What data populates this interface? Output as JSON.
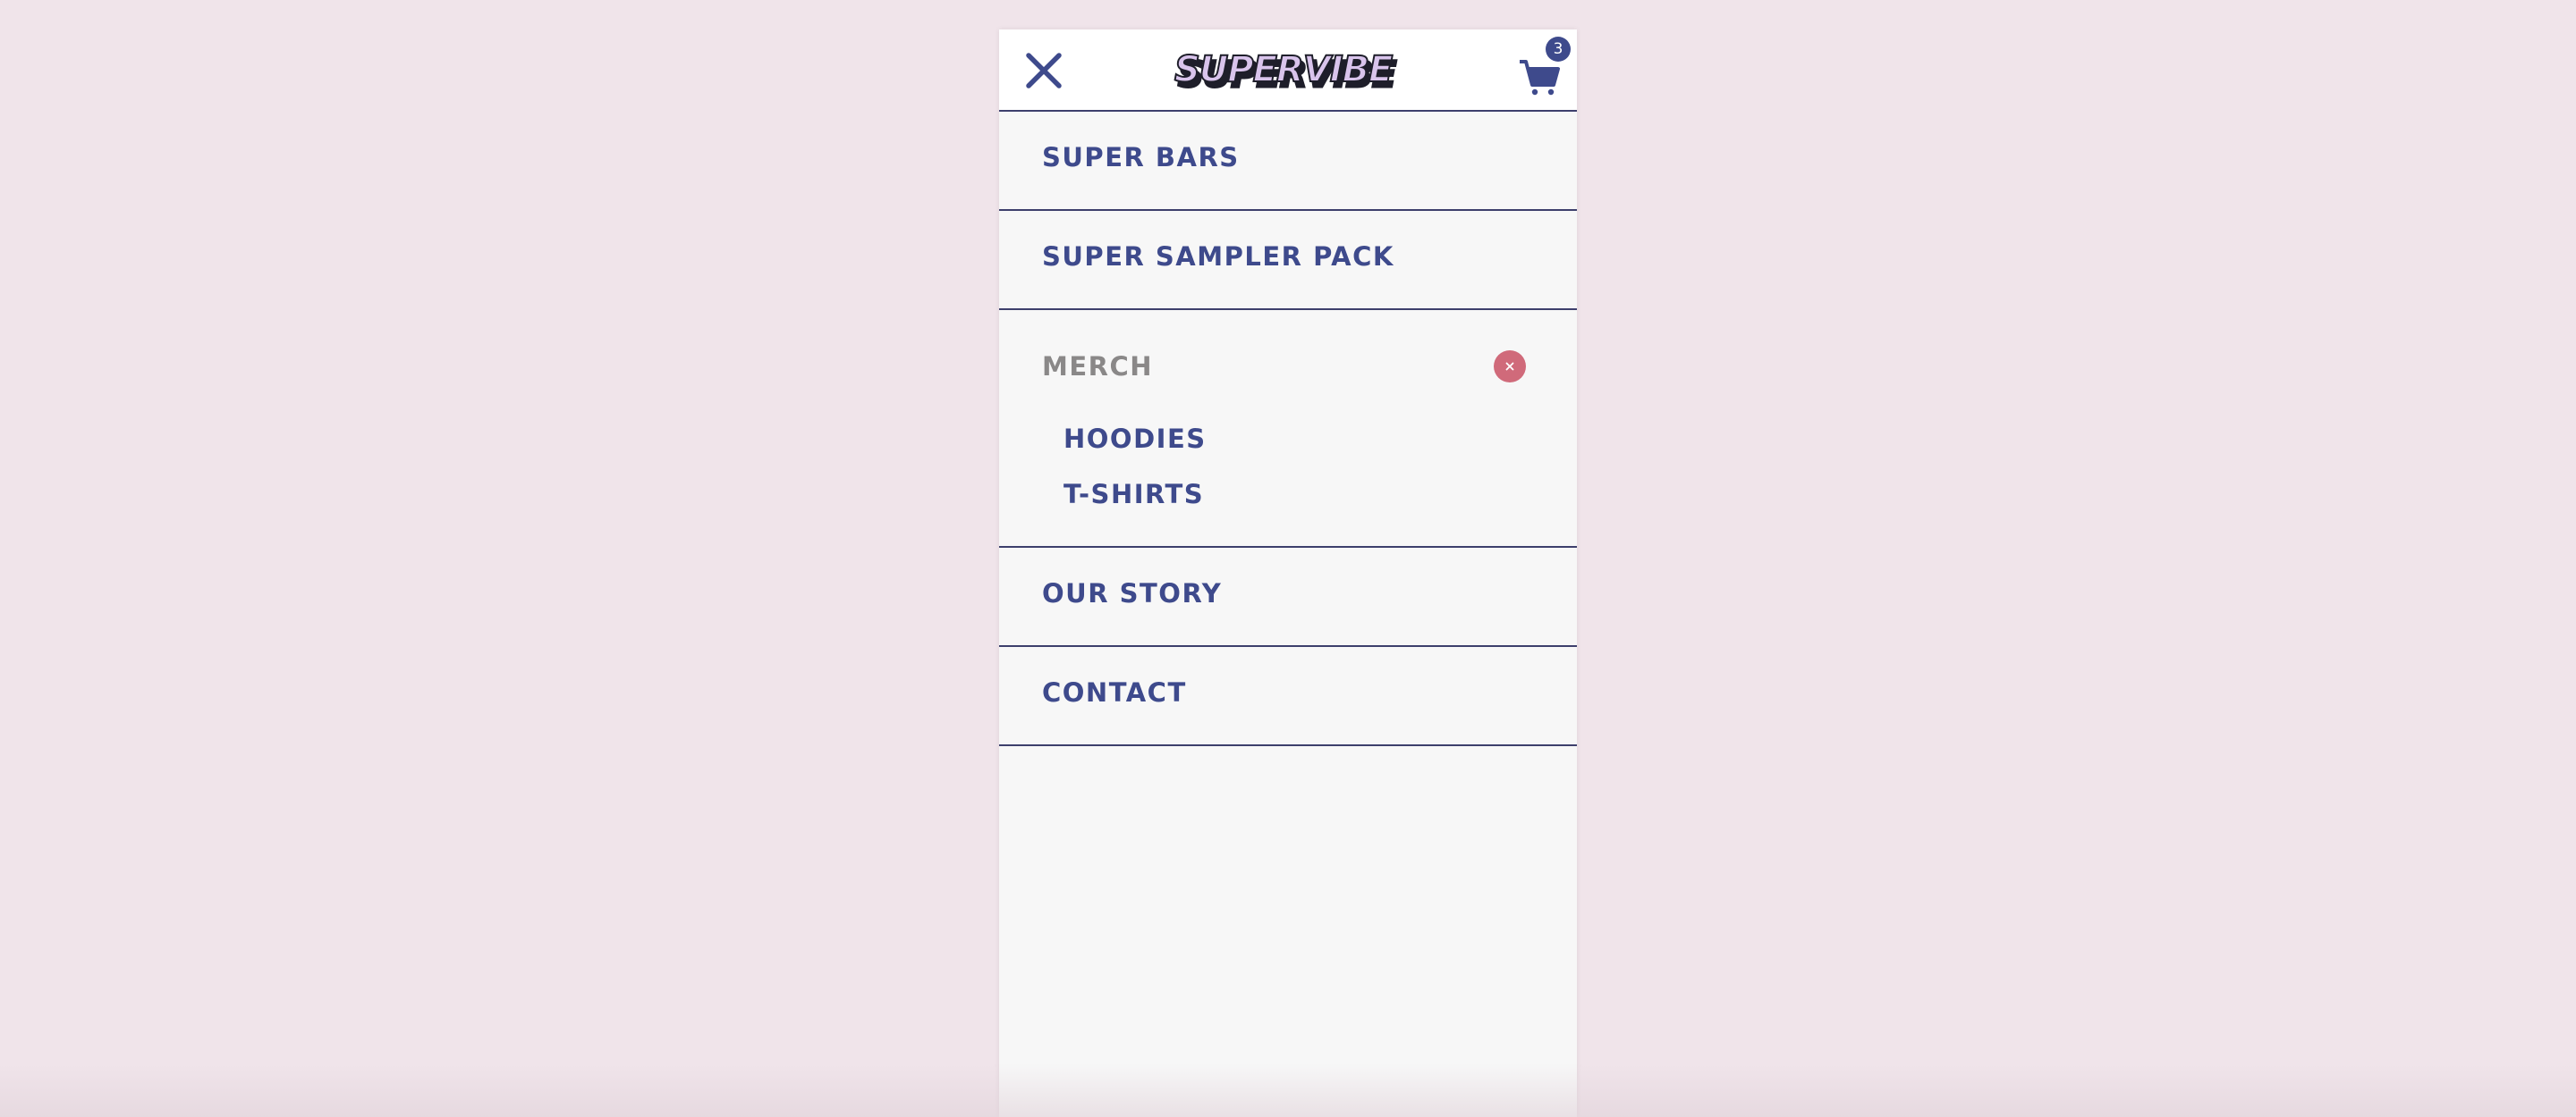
{
  "brand": {
    "logo_text": "SUPERVIBE",
    "logo_fill": "#d9c4ec",
    "logo_outline": "#1e1e2a",
    "accent": "#3e4a8c",
    "muted": "#8a8888",
    "collapse_color": "#d06a7a",
    "page_bg": "#f0e4ea"
  },
  "header": {
    "close_icon": "close-x-icon",
    "cart_icon": "shopping-cart-icon",
    "cart_count": "3"
  },
  "nav": {
    "items": [
      {
        "label": "SUPER BARS"
      },
      {
        "label": "SUPER SAMPLER PACK"
      },
      {
        "label": "MERCH",
        "expanded": true,
        "collapse_icon": "close-circle-icon",
        "children": [
          {
            "label": "HOODIES"
          },
          {
            "label": "T-SHIRTS"
          }
        ]
      },
      {
        "label": "OUR STORY"
      },
      {
        "label": "CONTACT"
      }
    ]
  }
}
